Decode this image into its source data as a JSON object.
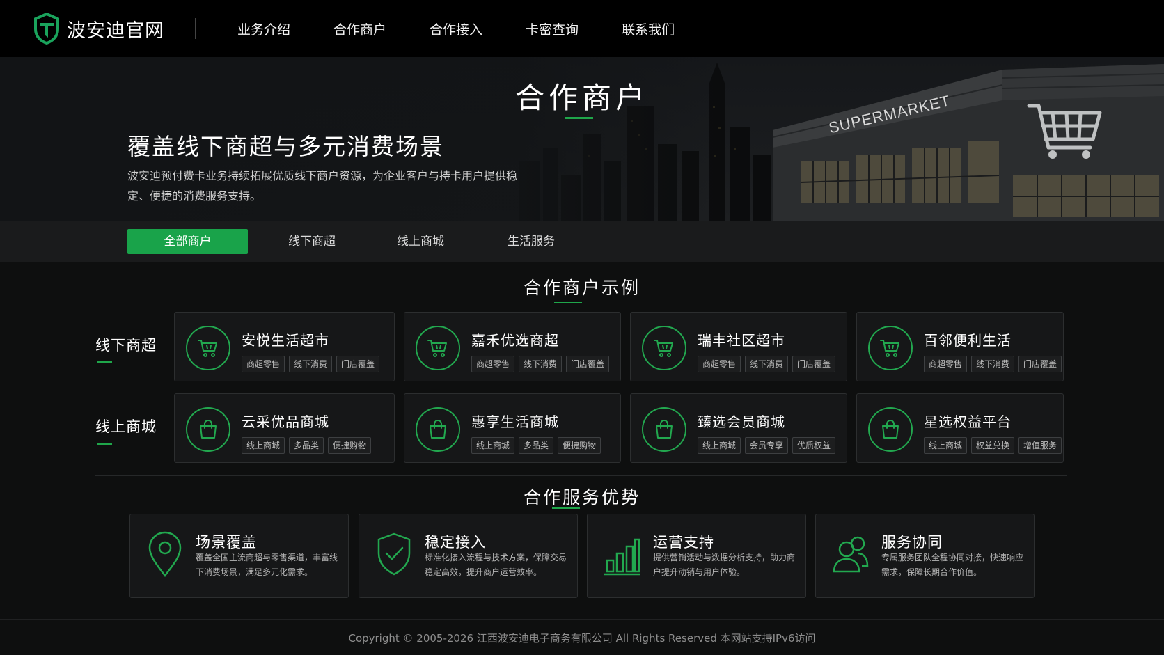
{
  "brand": {
    "name": "波安迪官网",
    "accent": "#19a34a"
  },
  "nav": {
    "items": [
      {
        "label": "业务介绍"
      },
      {
        "label": "合作商户"
      },
      {
        "label": "合作接入"
      },
      {
        "label": "卡密查询"
      },
      {
        "label": "联系我们"
      }
    ]
  },
  "hero": {
    "title": "合作商户",
    "subtitle": "覆盖线下商超与多元消费场景",
    "description": "波安迪预付费卡业务持续拓展优质线下商户资源，为企业客户与持卡用户提供稳定、便捷的消费服务支持。",
    "sign_text": "SUPERMARKET"
  },
  "tabs": [
    {
      "label": "全部商户",
      "active": true
    },
    {
      "label": "线下商超"
    },
    {
      "label": "线上商城"
    },
    {
      "label": "生活服务"
    }
  ],
  "merchants": {
    "title": "合作商户示例",
    "rows": [
      {
        "label": "线下商超",
        "icon": "shopping-cart-icon",
        "cards": [
          {
            "name": "安悦生活超市",
            "tags": [
              "商超零售",
              "线下消费",
              "门店覆盖"
            ]
          },
          {
            "name": "嘉禾优选商超",
            "tags": [
              "商超零售",
              "线下消费",
              "门店覆盖"
            ]
          },
          {
            "name": "瑞丰社区超市",
            "tags": [
              "商超零售",
              "线下消费",
              "门店覆盖"
            ]
          },
          {
            "name": "百邻便利生活",
            "tags": [
              "商超零售",
              "线下消费",
              "门店覆盖"
            ]
          }
        ]
      },
      {
        "label": "线上商城",
        "icon": "shopping-bag-icon",
        "cards": [
          {
            "name": "云采优品商城",
            "tags": [
              "线上商城",
              "多品类",
              "便捷购物"
            ]
          },
          {
            "name": "惠享生活商城",
            "tags": [
              "线上商城",
              "多品类",
              "便捷购物"
            ]
          },
          {
            "name": "臻选会员商城",
            "tags": [
              "线上商城",
              "会员专享",
              "优质权益"
            ]
          },
          {
            "name": "星选权益平台",
            "tags": [
              "线上商城",
              "权益兑换",
              "增值服务"
            ]
          }
        ]
      }
    ]
  },
  "advantages": {
    "title": "合作服务优势",
    "items": [
      {
        "title": "场景覆盖",
        "desc": "覆盖全国主流商超与零售渠道，丰富线下消费场景，满足多元化需求。",
        "icon": "location-pin-icon"
      },
      {
        "title": "稳定接入",
        "desc": "标准化接入流程与技术方案，保障交易稳定高效，提升商户运营效率。",
        "icon": "shield-check-icon"
      },
      {
        "title": "运营支持",
        "desc": "提供营销活动与数据分析支持，助力商户提升动销与用户体验。",
        "icon": "bar-chart-icon"
      },
      {
        "title": "服务协同",
        "desc": "专属服务团队全程协同对接，快速响应需求，保障长期合作价值。",
        "icon": "team-users-icon"
      }
    ]
  },
  "footer": {
    "copyright": "Copyright © 2005-2026 江西波安迪电子商务有限公司 All Rights Reserved 本网站支持IPv6访问"
  }
}
